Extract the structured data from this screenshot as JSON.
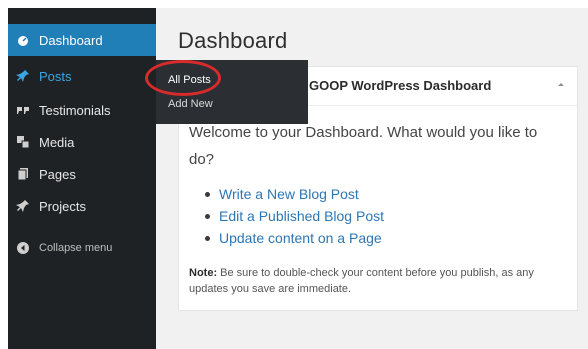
{
  "sidebar": {
    "items": [
      {
        "label": "Dashboard",
        "icon": "dashboard-icon"
      },
      {
        "label": "Posts",
        "icon": "pin-icon"
      },
      {
        "label": "Testimonials",
        "icon": "quote-icon"
      },
      {
        "label": "Media",
        "icon": "media-icon"
      },
      {
        "label": "Pages",
        "icon": "pages-icon"
      },
      {
        "label": "Projects",
        "icon": "pin-icon"
      },
      {
        "label": "Collapse menu",
        "icon": "collapse-icon"
      }
    ]
  },
  "submenu": {
    "items": [
      {
        "label": "All Posts"
      },
      {
        "label": "Add New"
      }
    ]
  },
  "main": {
    "title": "Dashboard",
    "panel": {
      "title": "GOOP WordPress Dashboard",
      "welcome": "Welcome to your Dashboard. What would you like to do?",
      "actions": [
        {
          "label": "Write a New Blog Post"
        },
        {
          "label": "Edit a Published Blog Post"
        },
        {
          "label": "Update content on a Page"
        }
      ],
      "note_label": "Note:",
      "note_text": " Be sure to double-check your content before you publish, as any updates you save are immediate."
    }
  },
  "colors": {
    "sidebar_bg": "#1f2225",
    "active_bg": "#1f7fb6",
    "open_text": "#3aa6e4",
    "link": "#2d76b4",
    "highlight_ring": "#d92b2b"
  }
}
